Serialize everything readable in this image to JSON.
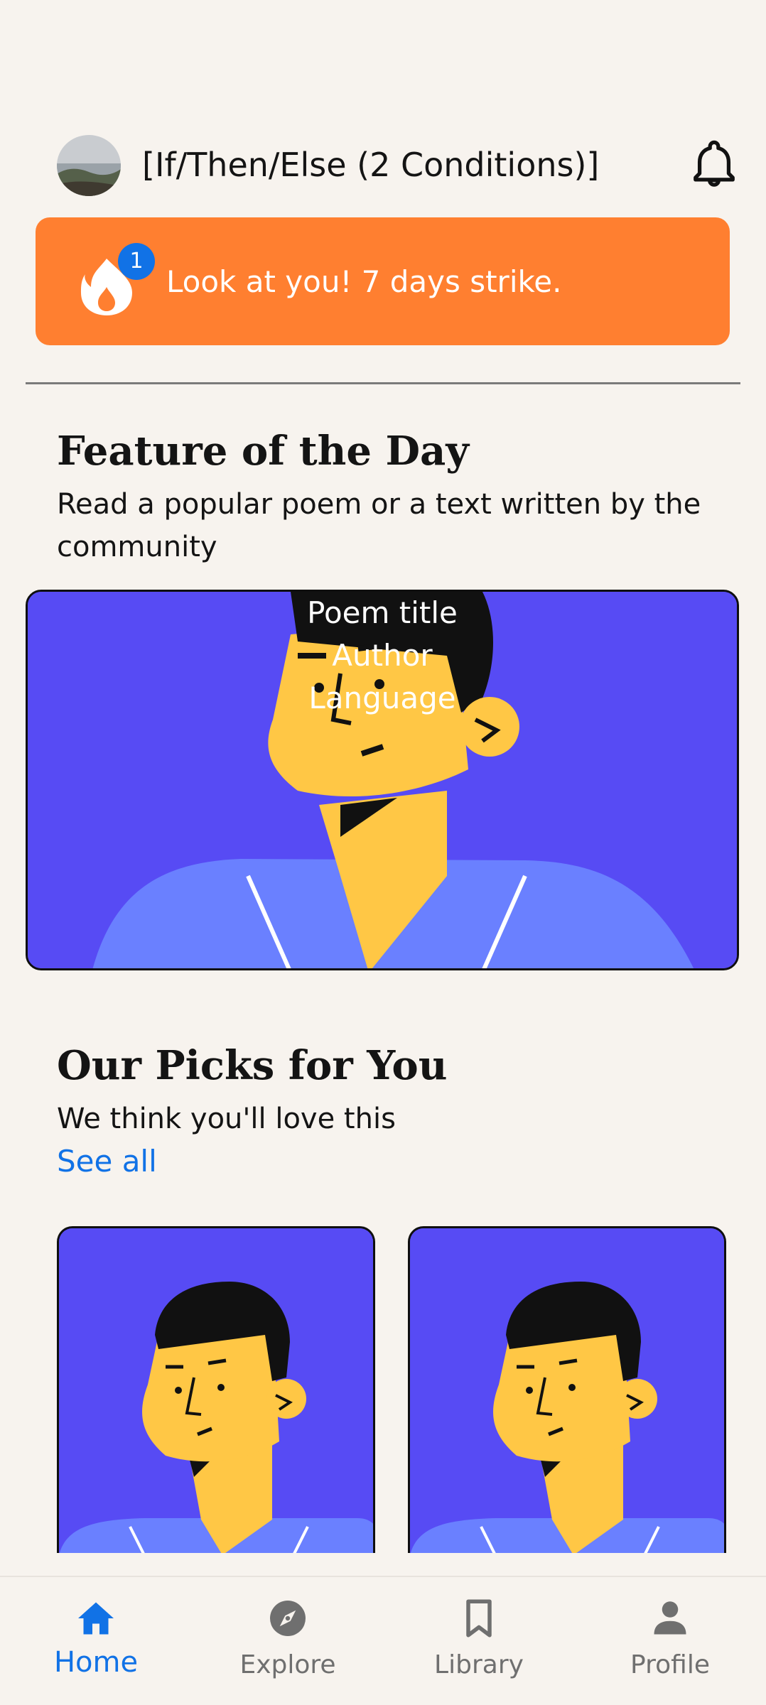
{
  "header": {
    "title": "[If/Then/Else (2 Conditions)]",
    "avatar_icon": "avatar-photo",
    "bell_icon": "bell-icon"
  },
  "streak": {
    "badge_count": "1",
    "text": "Look at you! 7 days strike.",
    "color": "#ff7f30",
    "icon": "fire-icon"
  },
  "feature": {
    "title": "Feature of the Day",
    "subtitle": "Read a popular poem or a text written by the community",
    "card": {
      "poem_title": "Poem title",
      "author": "Author",
      "language": "Language"
    }
  },
  "picks": {
    "title": "Our Picks for You",
    "subtitle": "We think you'll love this",
    "see_all": "See all"
  },
  "nav": {
    "items": [
      {
        "label": "Home",
        "icon": "home-icon",
        "active": true
      },
      {
        "label": "Explore",
        "icon": "compass-icon",
        "active": false
      },
      {
        "label": "Library",
        "icon": "bookmark-icon",
        "active": false
      },
      {
        "label": "Profile",
        "icon": "person-icon",
        "active": false
      }
    ]
  },
  "colors": {
    "background": "#f7f3ee",
    "accent": "#1172e6",
    "card": "#574bf4"
  }
}
